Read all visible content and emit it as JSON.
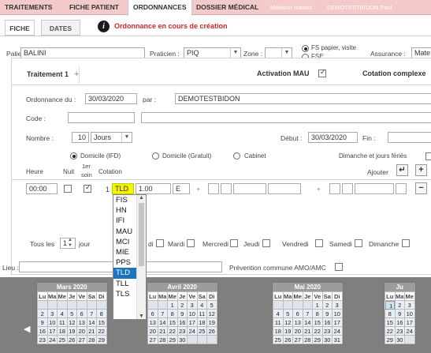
{
  "nav": {
    "items": [
      "TRAITEMENTS",
      "FICHE PATIENT",
      "ORDONNANCES",
      "DOSSIER MÉDICAL"
    ],
    "doctor_label": "Médecin traitant :",
    "doctor_name": "DEMOTESTBIDON Paul"
  },
  "tabs": {
    "fiche": "FICHE",
    "dates": "DATES"
  },
  "status": {
    "text": "Ordonnance en cours de création",
    "icon": "info-icon"
  },
  "header": {
    "patient_label": "Patient :",
    "patient_value": "BALINI",
    "praticien_label": "Praticien :",
    "praticien_value": "PIQ",
    "zone_label": "Zone :",
    "zone_value": "",
    "fs_papier": "FS papier, visite",
    "fse": "FSE",
    "assurance_label": "Assurance :",
    "assurance_value": "Mate"
  },
  "treatment": {
    "tab_label": "Traitement 1",
    "add_label": "+",
    "activation_label": "Activation MAU",
    "cotation_complexe": "Cotation complexe"
  },
  "form": {
    "ordonnance_label": "Ordonnance du :",
    "ordonnance_date": "30/03/2020",
    "par_label": "par :",
    "par_value": "DEMOTESTBIDON",
    "code_label": "Code :",
    "nombre_label": "Nombre :",
    "nombre_value": "10",
    "unit_value": "Jours",
    "debut_label": "Début :",
    "debut_value": "30/03/2020",
    "fin_label": "Fin :",
    "domicile_ifd": "Domicile (IFD)",
    "domicile_gratuit": "Domicile (Gratuit)",
    "cabinet": "Cabinet",
    "dimanche_feries": "Dimanche et jours fériés",
    "heure_label": "Heure",
    "nuit_label": "Nuit",
    "premier_soin_1": "1er",
    "premier_soin_2": "soin",
    "cotation_label": "Cotation",
    "ajouter_label": "Ajouter"
  },
  "row": {
    "heure": "00:00",
    "qty": "1",
    "code": "TLD",
    "coef": "1.00",
    "type": "E",
    "plus1": "+",
    "plus2": "+"
  },
  "dropdown": {
    "options": [
      "FIS",
      "HN",
      "IFI",
      "MAU",
      "MCI",
      "MIE",
      "PPS",
      "TLD",
      "TLL",
      "TLS"
    ],
    "selected": "TLD"
  },
  "days_row": {
    "tous_les": "Tous les",
    "value": "1",
    "jour": "jour",
    "days": [
      "di",
      "Mardi",
      "Mercredi",
      "Jeudi",
      "Vendredi",
      "Samedi",
      "Dimanche"
    ]
  },
  "lieu": {
    "label": "Lieu :",
    "prevention": "Prévention commune AMO/AMC"
  },
  "calendars": [
    {
      "title": "Mars 2020",
      "headers": [
        "Lu",
        "Ma",
        "Me",
        "Je",
        "Ve",
        "Sa",
        "Di"
      ],
      "rows": [
        [
          "",
          "",
          "",
          "",
          "",
          "",
          ""
        ],
        [
          "2",
          "3",
          "4",
          "5",
          "6",
          "7",
          "8"
        ],
        [
          "9",
          "10",
          "11",
          "12",
          "13",
          "14",
          "15"
        ],
        [
          "16",
          "17",
          "18",
          "19",
          "20",
          "21",
          "22"
        ],
        [
          "23",
          "24",
          "25",
          "26",
          "27",
          "28",
          "29"
        ]
      ]
    },
    {
      "title": "Avril 2020",
      "headers": [
        "Lu",
        "Ma",
        "Me",
        "Je",
        "Ve",
        "Sa",
        "Di"
      ],
      "rows": [
        [
          "",
          "",
          "1",
          "2",
          "3",
          "4",
          "5"
        ],
        [
          "6",
          "7",
          "8",
          "9",
          "10",
          "11",
          "12"
        ],
        [
          "13",
          "14",
          "15",
          "16",
          "17",
          "18",
          "19"
        ],
        [
          "20",
          "21",
          "22",
          "23",
          "24",
          "25",
          "26"
        ],
        [
          "27",
          "28",
          "29",
          "30",
          "",
          "",
          ""
        ]
      ]
    },
    {
      "title": "Mai 2020",
      "headers": [
        "Lu",
        "Ma",
        "Me",
        "Je",
        "Ve",
        "Sa",
        "Di"
      ],
      "rows": [
        [
          "",
          "",
          "",
          "",
          "1",
          "2",
          "3"
        ],
        [
          "4",
          "5",
          "6",
          "7",
          "8",
          "9",
          "10"
        ],
        [
          "11",
          "12",
          "13",
          "14",
          "15",
          "16",
          "17"
        ],
        [
          "18",
          "19",
          "20",
          "21",
          "22",
          "23",
          "24"
        ],
        [
          "25",
          "26",
          "27",
          "28",
          "29",
          "30",
          "31"
        ]
      ]
    },
    {
      "title": "Ju",
      "headers": [
        "Lu",
        "Ma",
        "Me"
      ],
      "rows": [
        [
          "1",
          "2",
          "3"
        ],
        [
          "8",
          "9",
          "10"
        ],
        [
          "15",
          "16",
          "17"
        ],
        [
          "22",
          "23",
          "24"
        ],
        [
          "29",
          "30",
          ""
        ]
      ]
    }
  ],
  "colors": {
    "nav_bg": "#f3c9c9",
    "accent_red": "#cc2a2a",
    "highlight": "#1e73be",
    "cotation_yellow": "#f5f500"
  }
}
